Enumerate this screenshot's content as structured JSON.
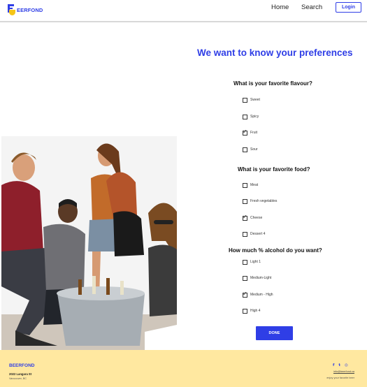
{
  "header": {
    "logo_text": "EERFOND",
    "nav": {
      "home": "Home",
      "search": "Search"
    },
    "login_label": "Login"
  },
  "preferences": {
    "title": "We want to know your preferences",
    "questions": [
      {
        "label": "What is your favorite flavour?",
        "options": [
          {
            "label": "Sweet",
            "checked": false
          },
          {
            "label": "Spicy",
            "checked": false
          },
          {
            "label": "Fruit",
            "checked": true
          },
          {
            "label": "Sour",
            "checked": false
          }
        ]
      },
      {
        "label": "What is your favorite food?",
        "options": [
          {
            "label": "Meat",
            "checked": false
          },
          {
            "label": "Fresh vegetables",
            "checked": false
          },
          {
            "label": "Cheese",
            "checked": true
          },
          {
            "label": "Dessert 4",
            "checked": false
          }
        ]
      },
      {
        "label": "How much % alcohol do you want?",
        "options": [
          {
            "label": "Light 1",
            "checked": false
          },
          {
            "label": "Medium-Light",
            "checked": false
          },
          {
            "label": "Medium - High",
            "checked": true
          },
          {
            "label": "High 4",
            "checked": false
          }
        ]
      }
    ],
    "done_label": "DONE"
  },
  "footer": {
    "brand": "BEERFOND",
    "address_line1": "2022 Langara St",
    "address_line2": "Vancouver, BC",
    "social": {
      "facebook": "f",
      "twitter": "t",
      "instagram": "◎"
    },
    "email": "info@beerfond.ca",
    "tagline": "enjoy your favorite beer"
  },
  "colors": {
    "accent": "#2f3ee6",
    "footer_bg": "#ffe8a0",
    "logo_yellow": "#f5c518"
  },
  "icons": [
    "logo-mark-icon",
    "checkbox-icon",
    "facebook-icon",
    "twitter-icon",
    "instagram-icon"
  ]
}
